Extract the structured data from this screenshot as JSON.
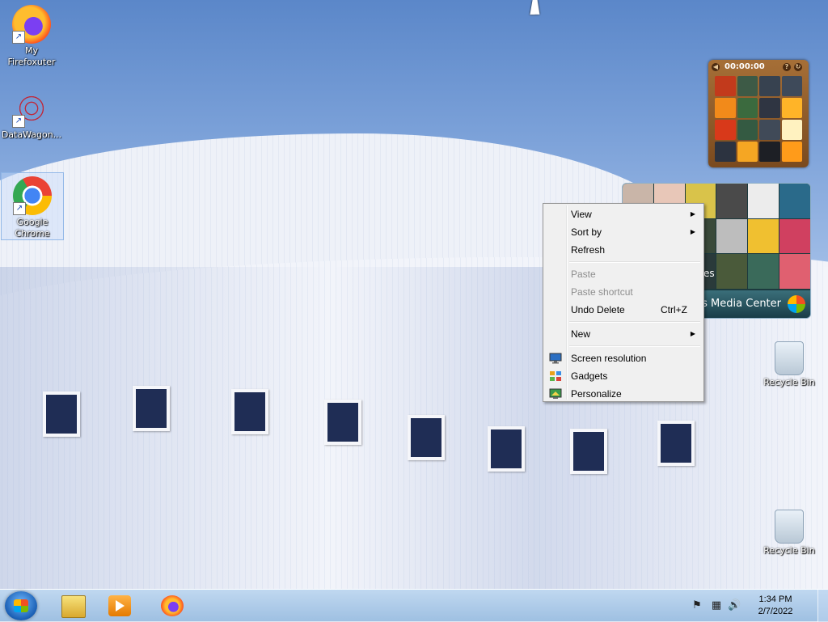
{
  "desktop": {
    "icons": [
      {
        "label": "My Firefoxuter",
        "icon": "firefox-icon"
      },
      {
        "label": "DataWagon...",
        "icon": "datawagon-icon"
      },
      {
        "label": "Google Chrome",
        "icon": "chrome-icon",
        "selected": true
      },
      {
        "label": "Recycle Bin",
        "icon": "recycle-bin-icon"
      },
      {
        "label": "Recycle Bin",
        "icon": "recycle-bin-icon"
      }
    ]
  },
  "gadgets": {
    "puzzle": {
      "timer": "00:00:00"
    },
    "media_center": {
      "label": "s Media Center",
      "tile_text": "es"
    }
  },
  "context_menu": {
    "items": [
      {
        "label": "View",
        "submenu": true
      },
      {
        "label": "Sort by",
        "submenu": true
      },
      {
        "label": "Refresh"
      },
      {
        "label": "Paste",
        "disabled": true
      },
      {
        "label": "Paste shortcut",
        "disabled": true
      },
      {
        "label": "Undo Delete",
        "shortcut": "Ctrl+Z"
      },
      {
        "label": "New",
        "submenu": true
      },
      {
        "label": "Screen resolution",
        "icon": "monitor-icon"
      },
      {
        "label": "Gadgets",
        "icon": "gadgets-icon"
      },
      {
        "label": "Personalize",
        "icon": "personalize-icon"
      }
    ]
  },
  "taskbar": {
    "pinned": [
      "windows-explorer-icon",
      "media-player-icon",
      "firefox-icon"
    ],
    "clock": {
      "time": "1:34 PM",
      "date": "2/7/2022"
    }
  },
  "colors": {
    "taskbar": "#9bbee1",
    "menu_background": "#f0f0f0"
  }
}
